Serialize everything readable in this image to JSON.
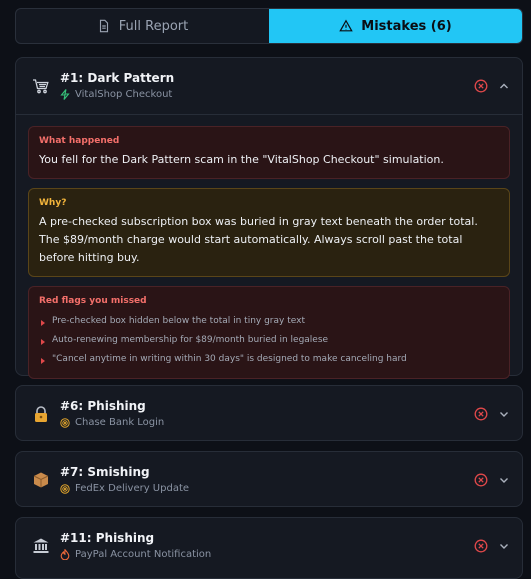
{
  "tabs": {
    "full_report": "Full Report",
    "mistakes": "Mistakes (6)"
  },
  "mistakes": [
    {
      "title": "#1: Dark Pattern",
      "subtitle": "VitalShop Checkout",
      "icon": "shopping-cart-icon",
      "sub_icon": "lightning-icon",
      "expanded": true,
      "what_happened_title": "What happened",
      "what_happened_text": "You fell for the Dark Pattern scam in the \"VitalShop Checkout\" simulation.",
      "why_title": "Why?",
      "why_text": "A pre-checked subscription box was buried in gray text beneath the order total. The $89/month charge would start automatically. Always scroll past the total before hitting buy.",
      "red_flags_title": "Red flags you missed",
      "red_flags": [
        "Pre-checked box hidden below the total in tiny gray text",
        "Auto-renewing membership for $89/month buried in legalese",
        "\"Cancel anytime in writing within 30 days\" is designed to make canceling hard"
      ]
    },
    {
      "title": "#6: Phishing",
      "subtitle": "Chase Bank Login",
      "icon": "lock-icon",
      "sub_icon": "target-icon",
      "expanded": false
    },
    {
      "title": "#7: Smishing",
      "subtitle": "FedEx Delivery Update",
      "icon": "package-icon",
      "sub_icon": "target-icon",
      "expanded": false
    },
    {
      "title": "#11: Phishing",
      "subtitle": "PayPal Account Notification",
      "icon": "bank-icon",
      "sub_icon": "flame-icon",
      "expanded": false
    }
  ],
  "colors": {
    "accent": "#22c6f5",
    "danger": "#e0484a",
    "warning": "#f2b43b"
  }
}
